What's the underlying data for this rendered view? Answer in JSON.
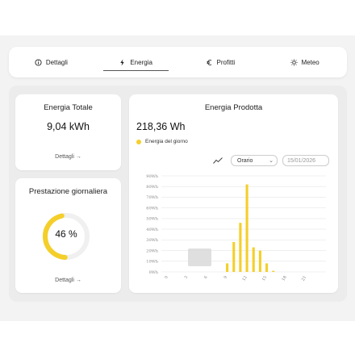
{
  "tabs": [
    {
      "label": "Dettagli",
      "icon": "info-icon"
    },
    {
      "label": "Energia",
      "icon": "lightning-icon"
    },
    {
      "label": "Profitti",
      "icon": "euro-icon"
    },
    {
      "label": "Meteo",
      "icon": "sun-icon"
    }
  ],
  "active_tab": "Energia",
  "energy_total": {
    "title": "Energia Totale",
    "value": "9,04 kWh",
    "link": "Dettagli →"
  },
  "daily_performance": {
    "title": "Prestazione giornaliera",
    "percent_label": "46 %",
    "percent": 46,
    "link": "Dettagli →"
  },
  "energy_produced": {
    "title": "Energia Prodotta",
    "value": "218,36 Wh",
    "legend": "Energia del giorno",
    "interval_select": "Orario",
    "date_field": "15/01/2026"
  },
  "colors": {
    "accent": "#f4cf2a",
    "bar": "#f4cf2a"
  },
  "chart_data": {
    "type": "bar",
    "series": [
      {
        "name": "Energia del giorno",
        "x": [
          9,
          10,
          11,
          12,
          13,
          14,
          15,
          16
        ],
        "values": [
          8,
          28,
          46,
          82,
          23,
          20,
          8,
          1
        ]
      }
    ],
    "y_ticks": [
      "0Wh",
      "10Wh",
      "20Wh",
      "30Wh",
      "40Wh",
      "50Wh",
      "60Wh",
      "70Wh",
      "80Wh",
      "90Wh"
    ],
    "x_ticks": [
      "0",
      "3",
      "6",
      "9",
      "12",
      "15",
      "18",
      "21"
    ],
    "ylim": [
      0,
      90
    ],
    "xlim": [
      -1,
      24
    ],
    "grid": true
  }
}
